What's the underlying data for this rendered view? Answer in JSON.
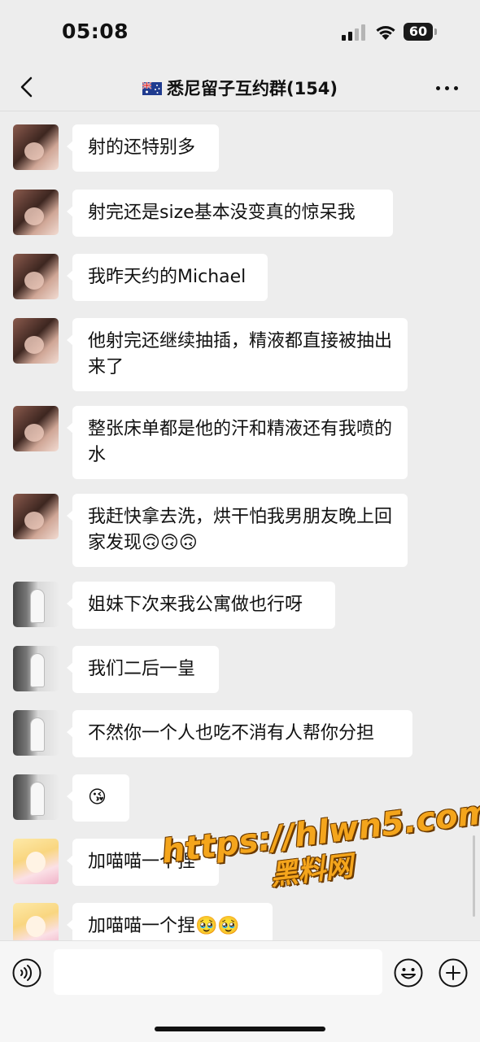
{
  "status_bar": {
    "time": "05:08",
    "battery": "60"
  },
  "nav": {
    "title": "悉尼留子互约群(154)",
    "flag_icon": "australia-flag-icon"
  },
  "messages": [
    {
      "sender": "a",
      "text": "射的还特别多"
    },
    {
      "sender": "a",
      "text": "射完还是size基本没变真的惊呆我"
    },
    {
      "sender": "a",
      "text": "我昨天约的Michael"
    },
    {
      "sender": "a",
      "text": "他射完还继续抽插，精液都直接被抽出来了"
    },
    {
      "sender": "a",
      "text": "整张床单都是他的汗和精液还有我喷的水"
    },
    {
      "sender": "a",
      "text": "我赶快拿去洗，烘干怕我男朋友晚上回家发现🙃🙃🙃"
    },
    {
      "sender": "b",
      "text": "姐妹下次来我公寓做也行呀"
    },
    {
      "sender": "b",
      "text": "我们二后一皇"
    },
    {
      "sender": "b",
      "text": "不然你一个人也吃不消有人帮你分担"
    },
    {
      "sender": "b",
      "text": "😘"
    },
    {
      "sender": "c",
      "text": "加喵喵一个捏"
    },
    {
      "sender": "c",
      "text": "加喵喵一个捏🥹🥹"
    }
  ],
  "watermark": {
    "url": "https://hlwn5.com",
    "name": "黑料网"
  },
  "input_bar": {
    "value": "",
    "placeholder": ""
  },
  "colors": {
    "background": "#ededed",
    "bubble": "#ffffff",
    "watermark": "#f4a51c"
  }
}
